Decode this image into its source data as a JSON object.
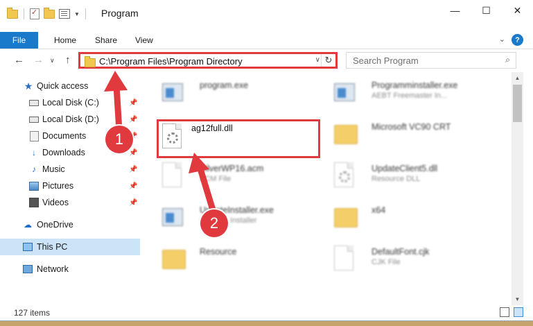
{
  "window": {
    "title": "Program",
    "controls": {
      "minimize": "—",
      "maximize": "☐",
      "close": "✕"
    }
  },
  "ribbon": {
    "tabs": [
      "File",
      "Home",
      "Share",
      "View"
    ],
    "help": "?"
  },
  "nav": {
    "address": "C:\\Program Files\\Program Directory",
    "search_placeholder": "Search Program"
  },
  "sidebar": {
    "quick_access": "Quick access",
    "items": [
      {
        "label": "Local Disk (C:)",
        "pinned": true
      },
      {
        "label": "Local Disk (D:)",
        "pinned": true
      },
      {
        "label": "Documents",
        "pinned": true
      },
      {
        "label": "Downloads",
        "pinned": true
      },
      {
        "label": "Music",
        "pinned": true
      },
      {
        "label": "Pictures",
        "pinned": true
      },
      {
        "label": "Videos",
        "pinned": true
      }
    ],
    "onedrive": "OneDrive",
    "this_pc": "This PC",
    "network": "Network"
  },
  "files": {
    "left": [
      {
        "name": "program.exe",
        "desc": ""
      },
      {
        "name": "ag12full.dll",
        "desc": ""
      },
      {
        "name": "SilverWP16.acm",
        "desc": "ACM File"
      },
      {
        "name": "UpdateInstaller.exe",
        "desc": "Updates Installer"
      },
      {
        "name": "Resource",
        "desc": ""
      }
    ],
    "right": [
      {
        "name": "Programminstaller.exe",
        "desc": "AEBT Freemaster In..."
      },
      {
        "name": "Microsoft VC90 CRT",
        "desc": ""
      },
      {
        "name": "UpdateClient5.dll",
        "desc": "Resource DLL"
      },
      {
        "name": "x64",
        "desc": ""
      },
      {
        "name": "DefaultFont.cjk",
        "desc": "CJK File"
      }
    ]
  },
  "status": {
    "item_count": "127 items"
  },
  "callouts": {
    "step1": "1",
    "step2": "2"
  },
  "colors": {
    "accent": "#1979ca",
    "highlight": "#e0393e",
    "folder": "#f3c64f"
  }
}
